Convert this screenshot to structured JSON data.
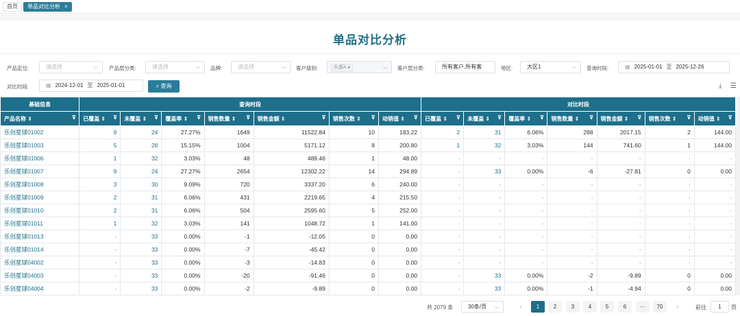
{
  "tabs": [
    {
      "label": "首页"
    },
    {
      "label": "单品对比分析",
      "close": "×"
    }
  ],
  "page_title": "单品对比分析",
  "filters": {
    "positioning": {
      "label": "产品定位:",
      "placeholder": "请选择"
    },
    "layer_cat": {
      "label": "产品层分类:",
      "placeholder": "请选择"
    },
    "brand": {
      "label": "品牌:",
      "placeholder": "请选择"
    },
    "cust_level": {
      "label": "客户级别:",
      "tag": "头部A"
    },
    "cust_layer": {
      "label": "客户层分类:",
      "value": "所有客户,所有客"
    },
    "region": {
      "label": "地区:",
      "value": "大区1"
    },
    "query_period": {
      "label": "查询时段:",
      "start": "2025-01-01",
      "to": "至",
      "end": "2025-12-26"
    },
    "compare_period": {
      "label": "对比时段:",
      "start": "2024-12-01",
      "to": "至",
      "end": "2025-01-01"
    },
    "query_button": "查询"
  },
  "table": {
    "groups": [
      "基础信息",
      "查询时段",
      "对比时段"
    ],
    "columns": [
      "产品名称",
      "已覆盖",
      "未覆盖",
      "覆盖率",
      "销售数量",
      "销售金额",
      "销售次数",
      "动销值",
      "已覆盖",
      "未覆盖",
      "覆盖率",
      "销售数量",
      "销售金额",
      "销售次数",
      "动销值"
    ],
    "rows": [
      [
        "乐创星球01002",
        "9",
        "24",
        "27.27%",
        "1649",
        "11522.84",
        "10",
        "183.22",
        "2",
        "31",
        "6.06%",
        "288",
        "2017.15",
        "2",
        "144.00"
      ],
      [
        "乐创星球01003",
        "5",
        "28",
        "15.15%",
        "1004",
        "5171.12",
        "8",
        "200.80",
        "1",
        "32",
        "3.03%",
        "144",
        "741.60",
        "1",
        "144.00"
      ],
      [
        "乐创星球01006",
        "1",
        "32",
        "3.03%",
        "48",
        "489.46",
        "1",
        "48.00",
        "-",
        "-",
        "-",
        "-",
        "-",
        "-",
        "-"
      ],
      [
        "乐创星球01007",
        "9",
        "24",
        "27.27%",
        "2654",
        "12302.22",
        "14",
        "294.89",
        "-",
        "33",
        "0.00%",
        "-6",
        "-27.81",
        "0",
        "0.00"
      ],
      [
        "乐创星球01008",
        "3",
        "30",
        "9.09%",
        "720",
        "3337.20",
        "6",
        "240.00",
        "-",
        "-",
        "-",
        "-",
        "-",
        "-",
        "-"
      ],
      [
        "乐创星球01009",
        "2",
        "31",
        "6.06%",
        "431",
        "2219.65",
        "4",
        "215.50",
        "-",
        "-",
        "-",
        "-",
        "-",
        "-",
        "-"
      ],
      [
        "乐创星球01010",
        "2",
        "31",
        "6.06%",
        "504",
        "2595.60",
        "5",
        "252.00",
        "-",
        "-",
        "-",
        "-",
        "-",
        "-",
        "-"
      ],
      [
        "乐创星球01011",
        "1",
        "32",
        "3.03%",
        "141",
        "1048.72",
        "1",
        "141.00",
        "-",
        "-",
        "-",
        "-",
        "-",
        "-",
        "-"
      ],
      [
        "乐创星球01013",
        "-",
        "33",
        "0.00%",
        "-1",
        "-12.05",
        "0",
        "0.00",
        "-",
        "-",
        "-",
        "-",
        "-",
        "-",
        "-"
      ],
      [
        "乐创星球01014",
        "-",
        "33",
        "0.00%",
        "-7",
        "-45.42",
        "0",
        "0.00",
        "-",
        "-",
        "-",
        "-",
        "-",
        "-",
        "-"
      ],
      [
        "乐创星球04002",
        "-",
        "33",
        "0.00%",
        "-3",
        "-14.83",
        "0",
        "0.00",
        "-",
        "-",
        "-",
        "-",
        "-",
        "-",
        "-"
      ],
      [
        "乐创星球04003",
        "-",
        "33",
        "0.00%",
        "-20",
        "-91.46",
        "0",
        "0.00",
        "-",
        "33",
        "0.00%",
        "-2",
        "-9.89",
        "0",
        "0.00"
      ],
      [
        "乐创星球04004",
        "-",
        "33",
        "0.00%",
        "-2",
        "-9.89",
        "0",
        "0.00",
        "-",
        "33",
        "0.00%",
        "-1",
        "-4.94",
        "0",
        "0.00"
      ]
    ]
  },
  "pagination": {
    "total": "共 2079 条",
    "page_size": "30条/页",
    "pages": [
      "1",
      "2",
      "3",
      "4",
      "5",
      "6",
      "···",
      "70"
    ],
    "prev": "‹",
    "next": "›",
    "goto_label": "前往",
    "goto_value": "1",
    "goto_unit": "页"
  }
}
